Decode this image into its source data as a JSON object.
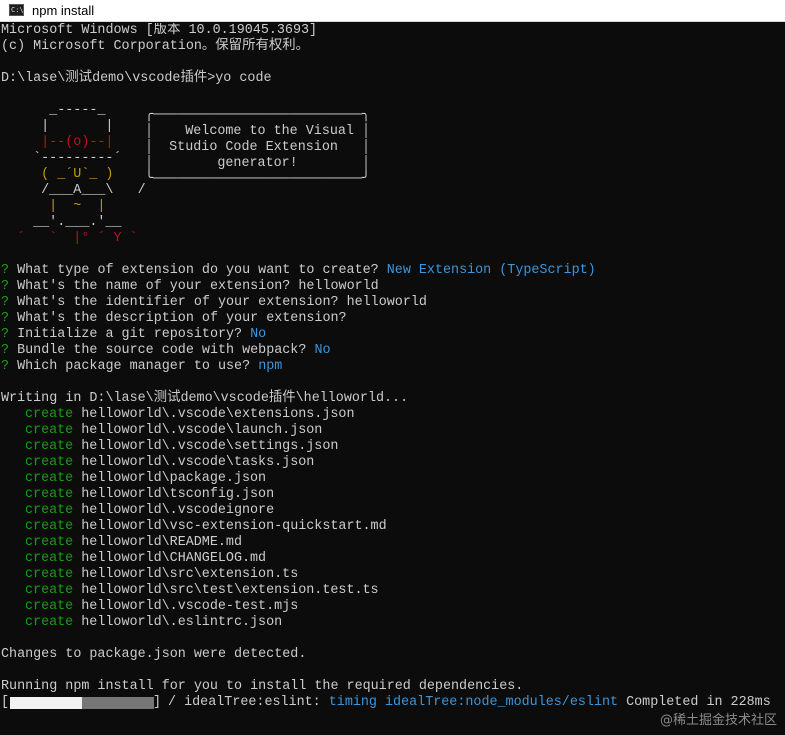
{
  "window": {
    "title": "npm install",
    "icon": "command-prompt-icon",
    "icon_text": "C:\\"
  },
  "terminal": {
    "banner": "Microsoft Windows [版本 10.0.19045.3693]",
    "copyright": "(c) Microsoft Corporation。保留所有权利。",
    "prompt": "D:\\lase\\测试demo\\vscode插件>yo code",
    "ascii_art": [
      "     _-----_     ",
      "    |       |    ",
      "    |--(o)--|    ",
      "   `---------´   ",
      "    ( _´U`_ )    ",
      "    /___A___\\   /",
      "     |  ~  |     ",
      "   __'.___.'__   ",
      " ´   `  |° ´ Y ` "
    ],
    "speech_bubble": [
      " ╭──────────────────────────╮",
      " │    Welcome to the Visual │",
      " │  Studio Code Extension   │",
      " │        generator!        │",
      " ╰──────────────────────────╯"
    ],
    "questions": [
      {
        "mark": "?",
        "question": "What type of extension do you want to create?",
        "answer": "New Extension (TypeScript)",
        "answer_color": "cyan"
      },
      {
        "mark": "?",
        "question": "What's the name of your extension?",
        "answer": "helloworld",
        "answer_color": "default"
      },
      {
        "mark": "?",
        "question": "What's the identifier of your extension?",
        "answer": "helloworld",
        "answer_color": "default"
      },
      {
        "mark": "?",
        "question": "What's the description of your extension?",
        "answer": "",
        "answer_color": "default"
      },
      {
        "mark": "?",
        "question": "Initialize a git repository?",
        "answer": "No",
        "answer_color": "cyan"
      },
      {
        "mark": "?",
        "question": "Bundle the source code with webpack?",
        "answer": "No",
        "answer_color": "cyan"
      },
      {
        "mark": "?",
        "question": "Which package manager to use?",
        "answer": "npm",
        "answer_color": "cyan"
      }
    ],
    "writing_line": "Writing in D:\\lase\\测试demo\\vscode插件\\helloworld...",
    "create_label": "create",
    "created_files": [
      "helloworld\\.vscode\\extensions.json",
      "helloworld\\.vscode\\launch.json",
      "helloworld\\.vscode\\settings.json",
      "helloworld\\.vscode\\tasks.json",
      "helloworld\\package.json",
      "helloworld\\tsconfig.json",
      "helloworld\\.vscodeignore",
      "helloworld\\vsc-extension-quickstart.md",
      "helloworld\\README.md",
      "helloworld\\CHANGELOG.md",
      "helloworld\\src\\extension.ts",
      "helloworld\\src\\test\\extension.test.ts",
      "helloworld\\.vscode-test.mjs",
      "helloworld\\.eslintrc.json"
    ],
    "changes_line": "Changes to package.json were detected.",
    "running_line": "Running npm install for you to install the required dependencies.",
    "progress": {
      "open": "[",
      "close": "]",
      "fraction": 0.5,
      "stage": " / idealTree:eslint: ",
      "status_word": "timing",
      "detail": "idealTree:node_modules/eslint",
      "completed": " Completed in 228ms"
    }
  },
  "colors": {
    "background": "#0c0c0c",
    "text": "#cccccc",
    "green": "#13a10e",
    "cyan": "#3a96dd",
    "yellow": "#c19c00",
    "red": "#c50f1f",
    "gray": "#767676"
  },
  "watermark": "@稀土掘金技术社区"
}
